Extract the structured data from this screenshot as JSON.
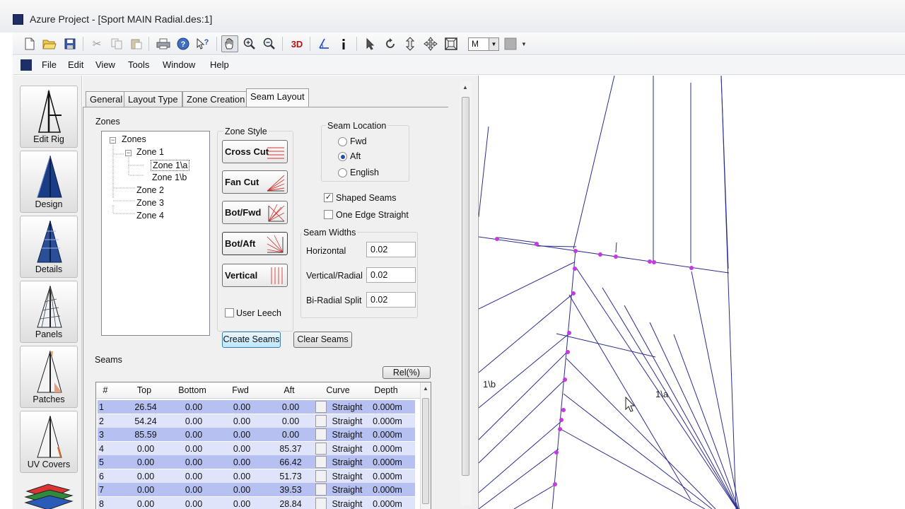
{
  "window": {
    "title": "Azure Project - [Sport MAIN Radial.des:1]"
  },
  "toolbar": {
    "icons": [
      "new-icon",
      "open-icon",
      "save-icon",
      "cut-icon",
      "copy-icon",
      "paste-icon",
      "print-icon",
      "help-icon",
      "context-help-icon",
      "pan-hand-icon",
      "zoom-in-icon",
      "zoom-out-icon",
      "3d-icon",
      "angle-icon",
      "info-icon",
      "select-arrow-icon",
      "rotate-icon",
      "move-vertical-icon",
      "move-icon",
      "fit-icon"
    ],
    "three_d_label": "3D",
    "mode_value": "M"
  },
  "menu": {
    "items": [
      "File",
      "Edit",
      "View",
      "Tools",
      "Window",
      "Help"
    ]
  },
  "sidebar": {
    "items": [
      {
        "label": "Edit Rig"
      },
      {
        "label": "Design"
      },
      {
        "label": "Details"
      },
      {
        "label": "Panels"
      },
      {
        "label": "Patches"
      },
      {
        "label": "UV Covers"
      }
    ]
  },
  "tabs": [
    {
      "label": "General"
    },
    {
      "label": "Layout Type"
    },
    {
      "label": "Zone Creation"
    },
    {
      "label": "Seam Layout"
    }
  ],
  "zones": {
    "heading": "Zones",
    "root": "Zones",
    "nodes": [
      "Zone 1",
      "Zone 1\\a",
      "Zone 1\\b",
      "Zone 2",
      "Zone 3",
      "Zone 4"
    ]
  },
  "zone_style": {
    "heading": "Zone Style",
    "buttons": [
      "Cross Cut",
      "Fan Cut",
      "Bot/Fwd",
      "Bot/Aft",
      "Vertical"
    ]
  },
  "seam_location": {
    "heading": "Seam Location",
    "options": [
      "Fwd",
      "Aft",
      "English"
    ],
    "selected": "Aft"
  },
  "options": {
    "shaped_seams": {
      "label": "Shaped Seams",
      "checked": true
    },
    "one_edge_straight": {
      "label": "One Edge Straight",
      "checked": false
    },
    "user_leech": {
      "label": "User Leech",
      "checked": false
    }
  },
  "seam_widths": {
    "heading": "Seam Widths",
    "fields": [
      {
        "label": "Horizontal",
        "value": "0.02"
      },
      {
        "label": "Vertical/Radial",
        "value": "0.02"
      },
      {
        "label": "Bi-Radial Split",
        "value": "0.02"
      }
    ]
  },
  "actions": {
    "create": "Create Seams",
    "clear": "Clear Seams",
    "rel": "Rel(%)"
  },
  "seams": {
    "heading": "Seams",
    "columns": [
      "#",
      "Top",
      "Bottom",
      "Fwd",
      "Aft",
      "Curve",
      "Depth"
    ],
    "rows": [
      [
        "1",
        "26.54",
        "0.00",
        "0.00",
        "0.00",
        "Straight",
        "0.000m"
      ],
      [
        "2",
        "54.24",
        "0.00",
        "0.00",
        "0.00",
        "Straight",
        "0.000m"
      ],
      [
        "3",
        "85.59",
        "0.00",
        "0.00",
        "0.00",
        "Straight",
        "0.000m"
      ],
      [
        "4",
        "0.00",
        "0.00",
        "0.00",
        "85.37",
        "Straight",
        "0.000m"
      ],
      [
        "5",
        "0.00",
        "0.00",
        "0.00",
        "66.42",
        "Straight",
        "0.000m"
      ],
      [
        "6",
        "0.00",
        "0.00",
        "0.00",
        "51.73",
        "Straight",
        "0.000m"
      ],
      [
        "7",
        "0.00",
        "0.00",
        "0.00",
        "39.53",
        "Straight",
        "0.000m"
      ],
      [
        "8",
        "0.00",
        "0.00",
        "0.00",
        "28.84",
        "Straight",
        "0.000m"
      ]
    ]
  },
  "canvas": {
    "labels": [
      "1\\b",
      "1\\a"
    ],
    "line_color": "#2b2d8c",
    "point_color": "#c638e0"
  }
}
